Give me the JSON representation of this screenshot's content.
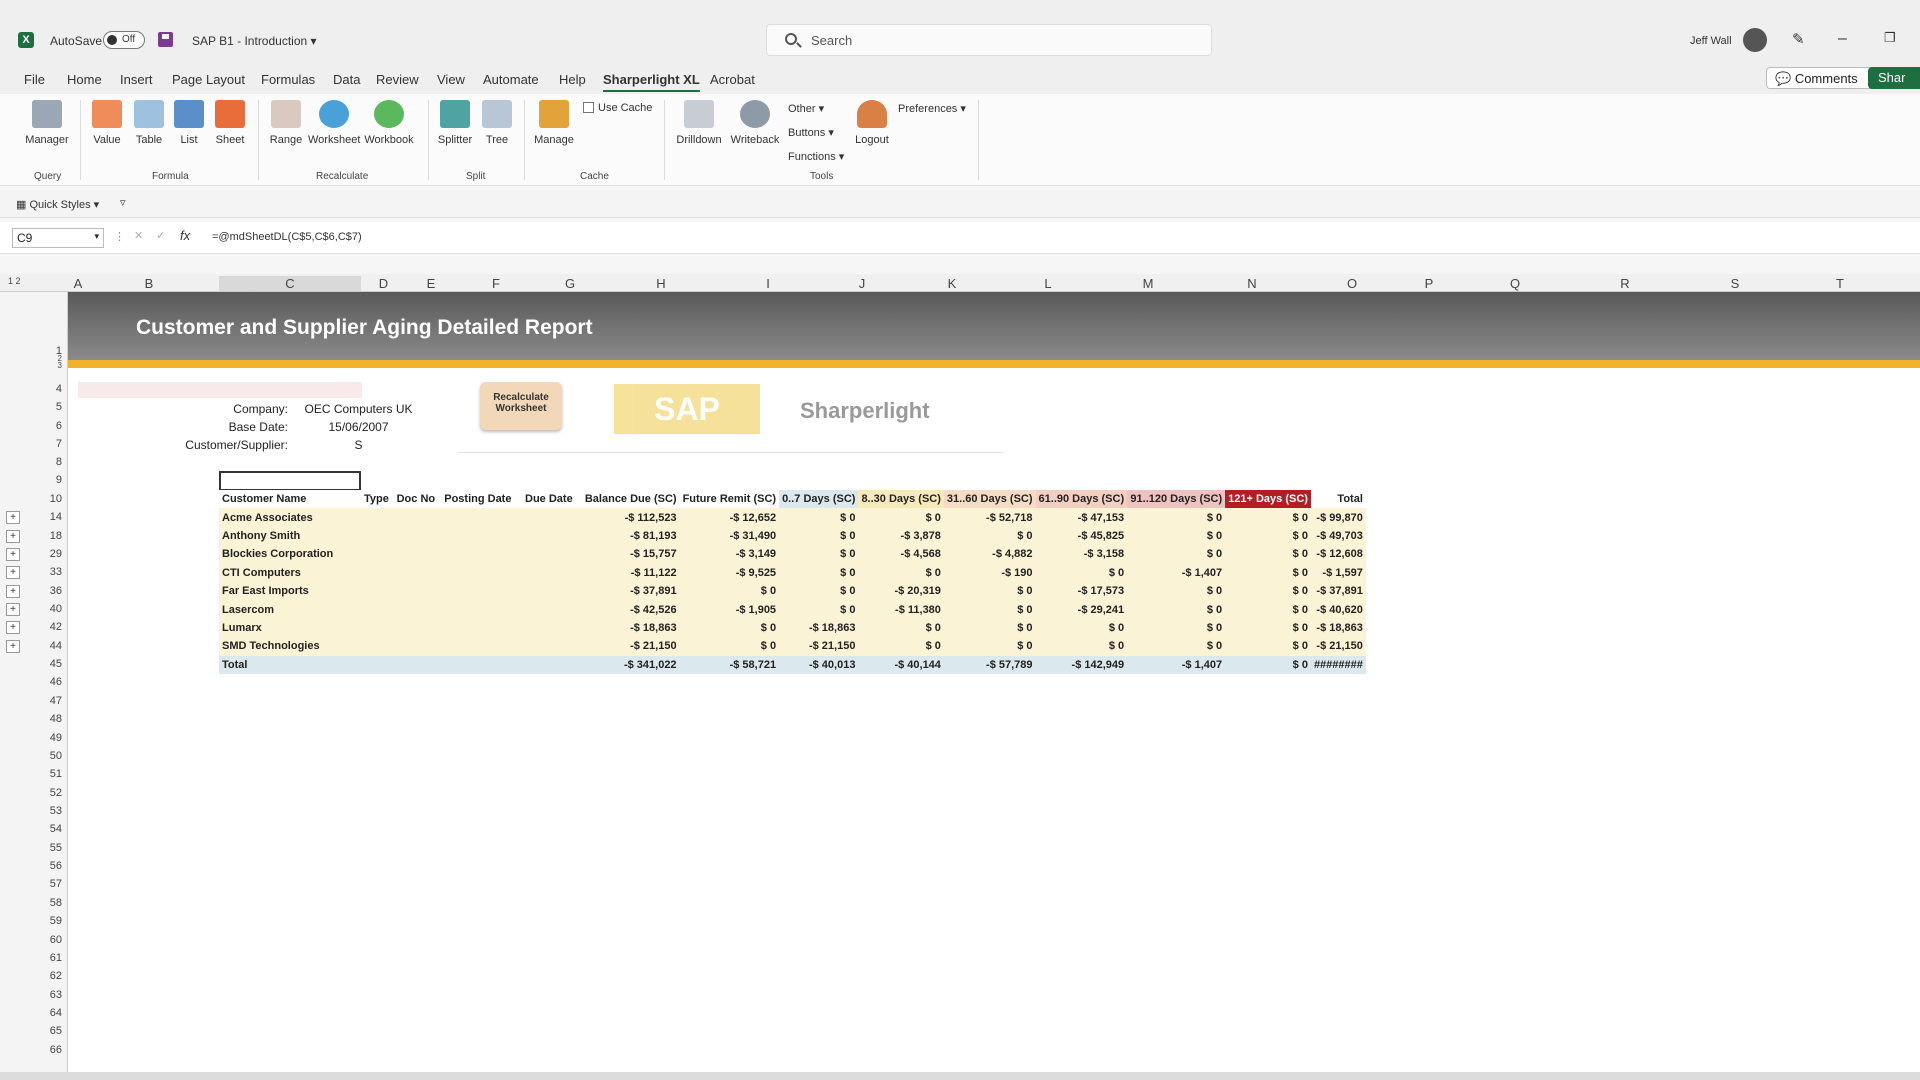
{
  "titlebar": {
    "autosave_label": "AutoSave",
    "autosave_state": "Off",
    "file_name": "SAP B1 - Introduction",
    "search_placeholder": "Search",
    "user_name": "Jeff Wall",
    "minimize": "–",
    "restore": "❐"
  },
  "menu": {
    "items": [
      "File",
      "Home",
      "Insert",
      "Page Layout",
      "Formulas",
      "Data",
      "Review",
      "View",
      "Automate",
      "Help",
      "Sharperlight XL",
      "Acrobat"
    ],
    "active": "Sharperlight XL",
    "comments_label": "Comments",
    "share_label": "Shar"
  },
  "ribbon": {
    "query": {
      "label": "Query",
      "buttons": [
        "Manager"
      ]
    },
    "formula": {
      "label": "Formula",
      "buttons": [
        "Value",
        "Table",
        "List",
        "Sheet"
      ]
    },
    "recalculate": {
      "label": "Recalculate",
      "buttons": [
        "Range",
        "Worksheet",
        "Workbook"
      ]
    },
    "split": {
      "label": "Split",
      "buttons": [
        "Splitter",
        "Tree"
      ]
    },
    "cache": {
      "label": "Cache",
      "buttons": [
        "Manage"
      ],
      "use_cache_label": "Use Cache"
    },
    "tools": {
      "label": "Tools",
      "buttons": [
        "Drilldown",
        "Writeback",
        "Logout"
      ],
      "dropdowns": [
        "Other",
        "Buttons",
        "Functions",
        "Preferences"
      ]
    }
  },
  "quick_styles_label": "Quick Styles",
  "formula_bar": {
    "name_box": "C9",
    "formula": "=@mdSheetDL(C$5,C$6,C$7)"
  },
  "columns": [
    "A",
    "B",
    "C",
    "D",
    "E",
    "F",
    "G",
    "H",
    "I",
    "J",
    "K",
    "L",
    "M",
    "N",
    "O",
    "P",
    "Q",
    "R",
    "S",
    "T"
  ],
  "rows": [
    "1",
    "2",
    "3",
    "4",
    "5",
    "6",
    "7",
    "8",
    "9",
    "10",
    "14",
    "18",
    "29",
    "33",
    "36",
    "40",
    "42",
    "44",
    "45",
    "46",
    "47",
    "48",
    "49",
    "50",
    "51",
    "52",
    "53",
    "54",
    "55",
    "56",
    "57",
    "58",
    "59",
    "60",
    "61",
    "62",
    "63",
    "64",
    "65",
    "66"
  ],
  "report": {
    "title": "Customer and Supplier Aging Detailed Report",
    "params": {
      "company_label": "Company:",
      "company": "OEC Computers UK",
      "base_date_label": "Base Date:",
      "base_date": "15/06/2007",
      "cust_label": "Customer/Supplier:",
      "cust": "S"
    },
    "recalc_button": "Recalculate Worksheet",
    "sap_logo_text": "SAP",
    "sharperlight_logo_text": "Sharperlight",
    "headers": [
      "Customer Name",
      "Type",
      "Doc No",
      "Posting Date",
      "Due Date",
      "Balance Due (SC)",
      "Future Remit (SC)",
      "0..7 Days (SC)",
      "8..30 Days (SC)",
      "31..60 Days (SC)",
      "61..90 Days (SC)",
      "91..120 Days (SC)",
      "121+ Days (SC)",
      "Total"
    ],
    "header_colors": {
      "d0_7": "#dbe8ed",
      "d8_30": "#f6ebb8",
      "d31_60": "#f6dcc4",
      "d61_90": "#f2cfc0",
      "d91_120": "#edc2c0",
      "d121": "#b31e23"
    },
    "rows": [
      [
        "Acme Associates",
        "",
        "",
        "",
        "",
        "-$ 112,523",
        "-$ 12,652",
        "$ 0",
        "$ 0",
        "-$ 52,718",
        "-$ 47,153",
        "$ 0",
        "$ 0",
        "-$ 99,870"
      ],
      [
        "Anthony Smith",
        "",
        "",
        "",
        "",
        "-$ 81,193",
        "-$ 31,490",
        "$ 0",
        "-$ 3,878",
        "$ 0",
        "-$ 45,825",
        "$ 0",
        "$ 0",
        "-$ 49,703"
      ],
      [
        "Blockies Corporation",
        "",
        "",
        "",
        "",
        "-$ 15,757",
        "-$ 3,149",
        "$ 0",
        "-$ 4,568",
        "-$ 4,882",
        "-$ 3,158",
        "$ 0",
        "$ 0",
        "-$ 12,608"
      ],
      [
        "CTI Computers",
        "",
        "",
        "",
        "",
        "-$ 11,122",
        "-$ 9,525",
        "$ 0",
        "$ 0",
        "-$ 190",
        "$ 0",
        "-$ 1,407",
        "$ 0",
        "-$ 1,597"
      ],
      [
        "Far East Imports",
        "",
        "",
        "",
        "",
        "-$ 37,891",
        "$ 0",
        "$ 0",
        "-$ 20,319",
        "$ 0",
        "-$ 17,573",
        "$ 0",
        "$ 0",
        "-$ 37,891"
      ],
      [
        "Lasercom",
        "",
        "",
        "",
        "",
        "-$ 42,526",
        "-$ 1,905",
        "$ 0",
        "-$ 11,380",
        "$ 0",
        "-$ 29,241",
        "$ 0",
        "$ 0",
        "-$ 40,620"
      ],
      [
        "Lumarx",
        "",
        "",
        "",
        "",
        "-$ 18,863",
        "$ 0",
        "-$ 18,863",
        "$ 0",
        "$ 0",
        "$ 0",
        "$ 0",
        "$ 0",
        "-$ 18,863"
      ],
      [
        "SMD Technologies",
        "",
        "",
        "",
        "",
        "-$ 21,150",
        "$ 0",
        "-$ 21,150",
        "$ 0",
        "$ 0",
        "$ 0",
        "$ 0",
        "$ 0",
        "-$ 21,150"
      ]
    ],
    "total_row": [
      "Total",
      "",
      "",
      "",
      "",
      "-$ 341,022",
      "-$ 58,721",
      "-$ 40,013",
      "-$ 40,144",
      "-$ 57,789",
      "-$ 142,949",
      "-$ 1,407",
      "$ 0",
      "########"
    ]
  }
}
